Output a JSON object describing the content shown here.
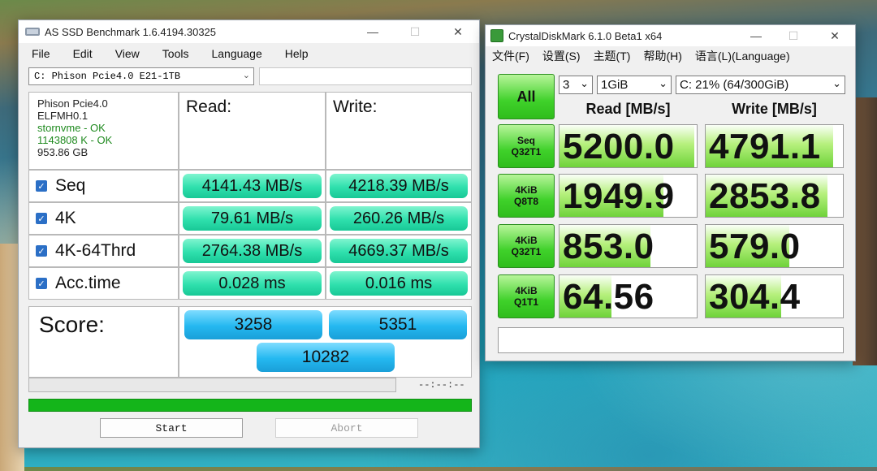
{
  "asssd": {
    "title": "AS SSD Benchmark 1.6.4194.30325",
    "menu": [
      "File",
      "Edit",
      "View",
      "Tools",
      "Language",
      "Help"
    ],
    "drive_select": "C: Phison Pcie4.0 E21-1TB",
    "info": {
      "model": "Phison Pcie4.0",
      "firmware": "ELFMH0.1",
      "driver": "stornvme - OK",
      "alignment": "1143808 K - OK",
      "capacity": "953.86 GB"
    },
    "headers": {
      "read": "Read:",
      "write": "Write:"
    },
    "rows": [
      {
        "label": "Seq",
        "read": "4141.43 MB/s",
        "write": "4218.39 MB/s",
        "checked": true
      },
      {
        "label": "4K",
        "read": "79.61 MB/s",
        "write": "260.26 MB/s",
        "checked": true
      },
      {
        "label": "4K-64Thrd",
        "read": "2764.38 MB/s",
        "write": "4669.37 MB/s",
        "checked": true
      },
      {
        "label": "Acc.time",
        "read": "0.028 ms",
        "write": "0.016 ms",
        "checked": true
      }
    ],
    "score": {
      "label": "Score:",
      "read": "3258",
      "write": "5351",
      "total": "10282"
    },
    "time_text": "--:--:--",
    "progress": 1.0,
    "buttons": {
      "start": "Start",
      "abort": "Abort"
    }
  },
  "cdm": {
    "title": "CrystalDiskMark 6.1.0 Beta1 x64",
    "menu": [
      "文件(F)",
      "设置(S)",
      "主题(T)",
      "帮助(H)",
      "语言(L)(Language)"
    ],
    "all_label": "All",
    "count": "3",
    "size": "1GiB",
    "drive": "C: 21% (64/300GiB)",
    "headers": {
      "read": "Read [MB/s]",
      "write": "Write [MB/s]"
    },
    "tests": [
      {
        "line1": "Seq",
        "line2": "Q32T1",
        "read": "5200.0",
        "write": "4791.1",
        "read_fill": 0.98,
        "write_fill": 0.93
      },
      {
        "line1": "4KiB",
        "line2": "Q8T8",
        "read": "1949.9",
        "write": "2853.8",
        "read_fill": 0.76,
        "write_fill": 0.89
      },
      {
        "line1": "4KiB",
        "line2": "Q32T1",
        "read": "853.0",
        "write": "579.0",
        "read_fill": 0.66,
        "write_fill": 0.61
      },
      {
        "line1": "4KiB",
        "line2": "Q1T1",
        "read": "64.56",
        "write": "304.4",
        "read_fill": 0.38,
        "write_fill": 0.55
      }
    ],
    "comment": ""
  },
  "icons": {
    "close": "✕",
    "minimize": "—",
    "maximize": "☐",
    "check": "✓",
    "dropdown": "⌄"
  }
}
